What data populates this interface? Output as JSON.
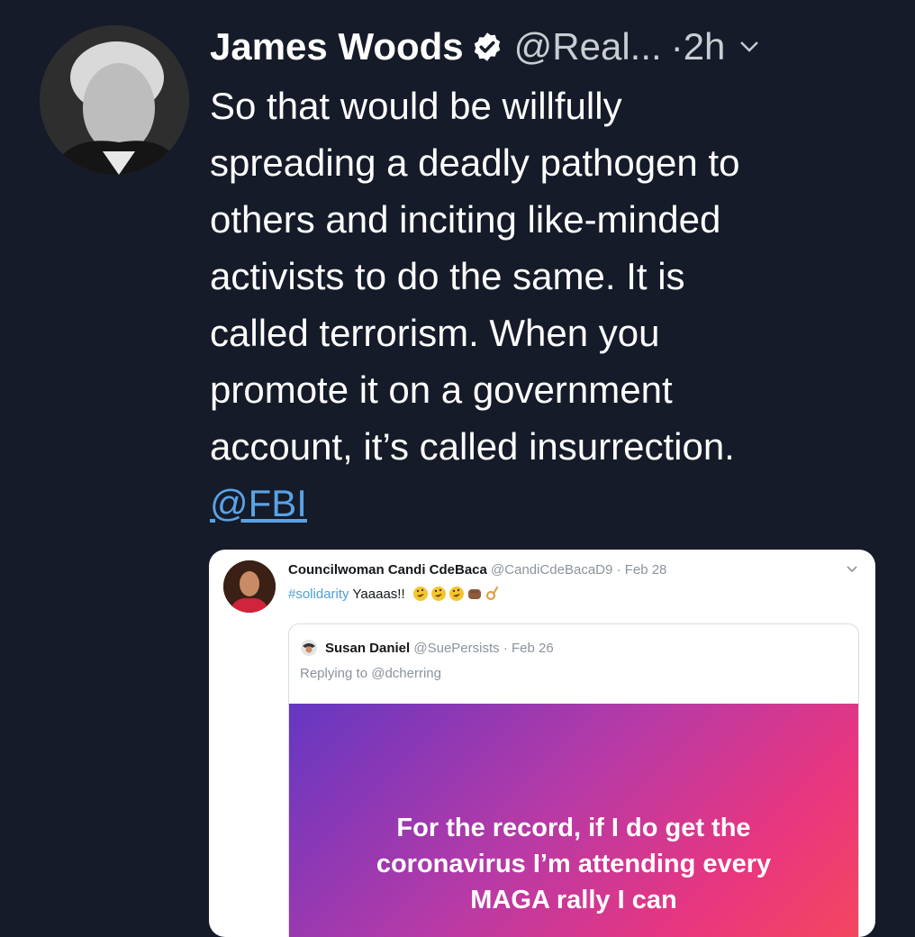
{
  "tweet": {
    "author_name": "James Woods",
    "handle": "@Real...",
    "separator": "·",
    "time": "2h",
    "text_lines": [
      "So that would be willfully",
      "spreading a deadly pathogen to",
      "others and inciting like-minded",
      "activists to do the same. It is",
      "called terrorism. When you",
      "promote it on a government",
      "account, it’s called insurrection."
    ],
    "mention": "@FBI"
  },
  "quote": {
    "author_name": "Councilwoman Candi CdeBaca",
    "handle": "@CandiCdeBacaD9",
    "date": "· Feb 28",
    "hashtag": "#solidarity",
    "text": "Yaaaas!!",
    "emojis": [
      "rofl-emoji",
      "rofl-emoji",
      "rofl-emoji",
      "fist-emoji",
      "ok-hand-emoji"
    ],
    "nested": {
      "author_name": "Susan Daniel",
      "handle": "@SuePersists",
      "date": "· Feb 26",
      "replying_to": "Replying to @dcherring",
      "story_lines": [
        "For the record, if I do get the",
        "coronavirus I’m attending every",
        "MAGA rally I can"
      ]
    }
  },
  "colors": {
    "background": "#151b28",
    "link": "#5aa2e6",
    "hashtag": "#4ea0d8"
  }
}
